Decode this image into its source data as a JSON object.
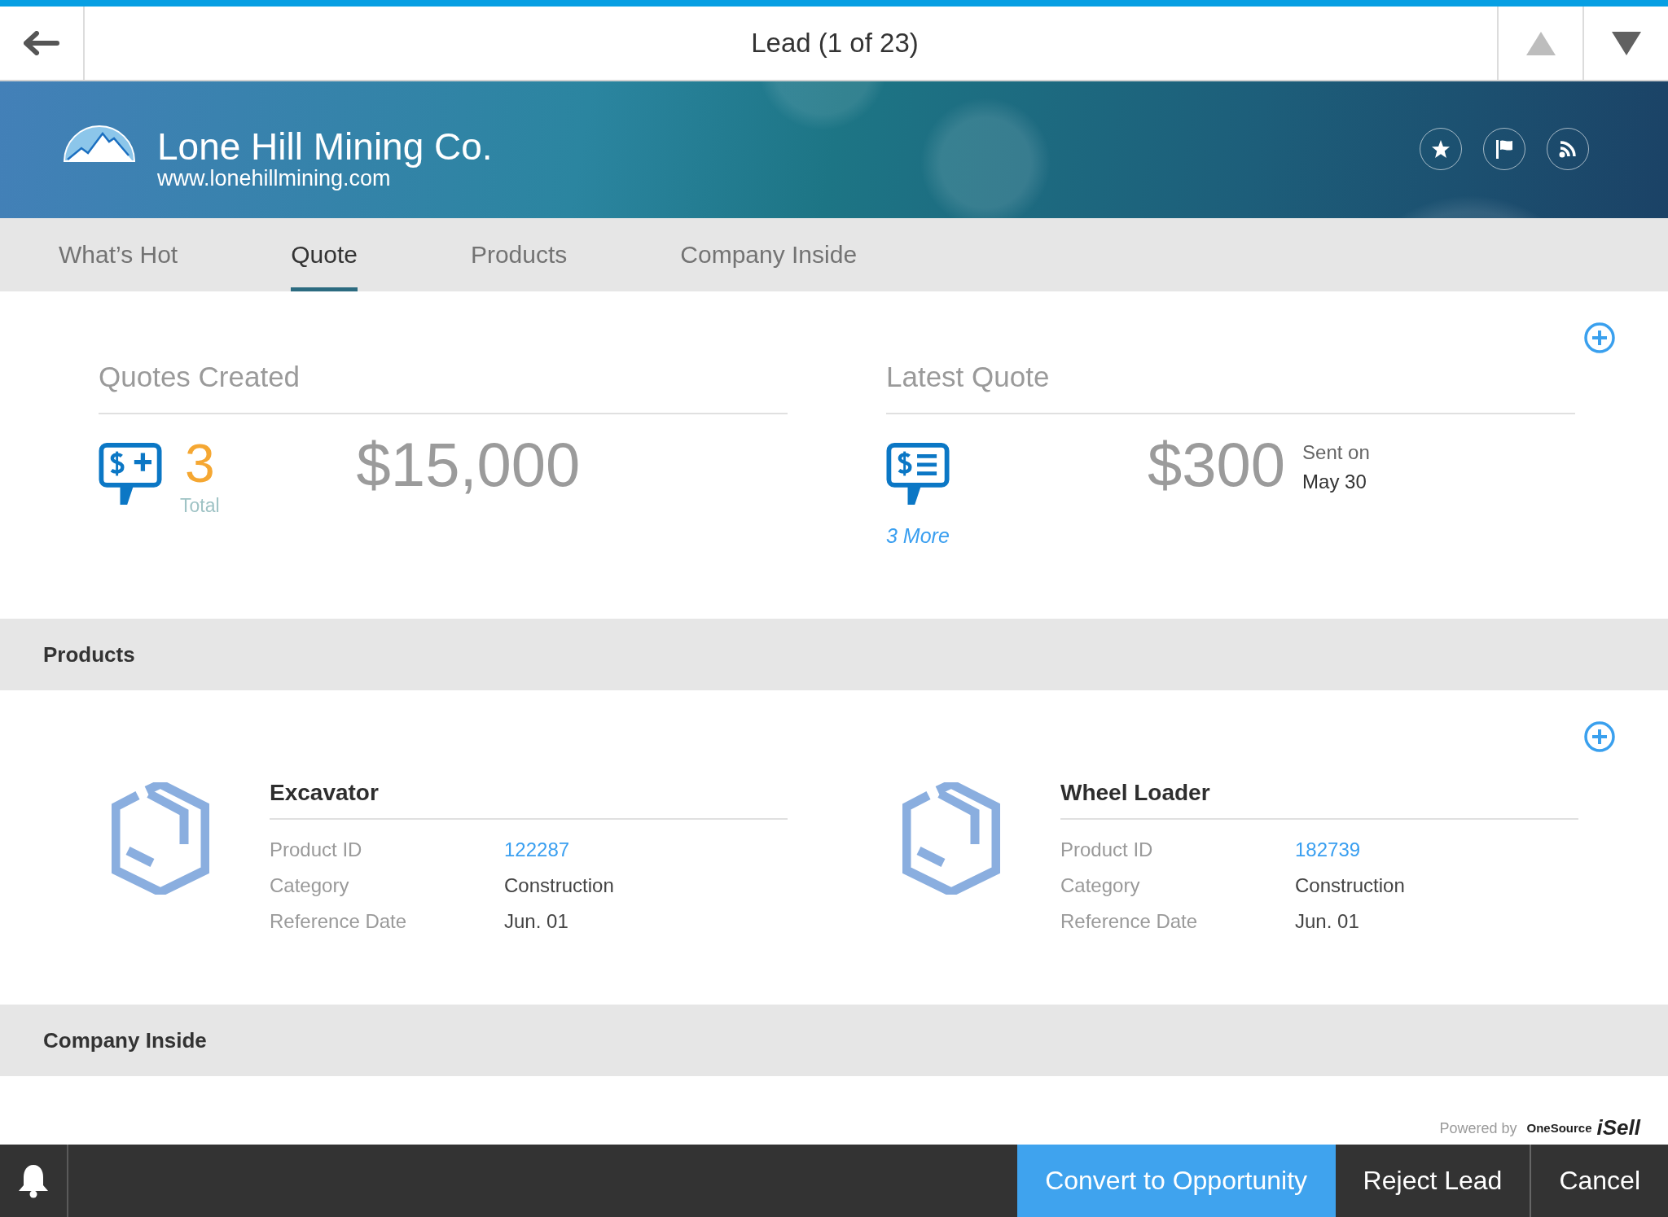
{
  "top_bar": {
    "title": "Lead (1 of 23)",
    "nav_buttons": [
      {
        "kind": "previous",
        "disabled": true
      },
      {
        "kind": "next",
        "disabled": false
      }
    ]
  },
  "header": {
    "company": "Lone Hill Mining Co.",
    "website": "www.lonehillmining.com"
  },
  "tabs": [
    {
      "label": "What’s Hot",
      "selected": false
    },
    {
      "label": "Quote",
      "selected": true
    },
    {
      "label": "Products",
      "selected": false
    },
    {
      "label": "Company Inside",
      "selected": false
    }
  ],
  "quotes_created": {
    "title": "Quotes Created",
    "count": "3",
    "count_label": "Total",
    "amount": "$15,000"
  },
  "latest_quote": {
    "title": "Latest Quote",
    "amount": "$300",
    "sent_label": "Sent on",
    "sent_date": "May 30",
    "more_link": "3 More"
  },
  "products": {
    "title": "Products",
    "items": [
      {
        "name": "Excavator",
        "fields": [
          {
            "label": "Product ID",
            "value": "122287",
            "kind": "link"
          },
          {
            "label": "Category",
            "value": "Construction",
            "kind": "text"
          },
          {
            "label": "Reference Date",
            "value": "Jun. 01",
            "kind": "text"
          }
        ]
      },
      {
        "name": "Wheel Loader",
        "fields": [
          {
            "label": "Product ID",
            "value": "182739",
            "kind": "link"
          },
          {
            "label": "Category",
            "value": "Construction",
            "kind": "text"
          },
          {
            "label": "Reference Date",
            "value": "Jun. 01",
            "kind": "text"
          }
        ]
      }
    ]
  },
  "company_inside": {
    "title": "Company Inside"
  },
  "footer": {
    "powered_by": "Powered by",
    "brand": "OneSource",
    "product": "iSell"
  },
  "bottom_bar": {
    "actions": [
      {
        "label": "Convert to Opportunity",
        "kind": "primary"
      },
      {
        "label": "Reject Lead",
        "kind": "secondary"
      },
      {
        "label": "Cancel",
        "kind": "secondary"
      }
    ]
  }
}
